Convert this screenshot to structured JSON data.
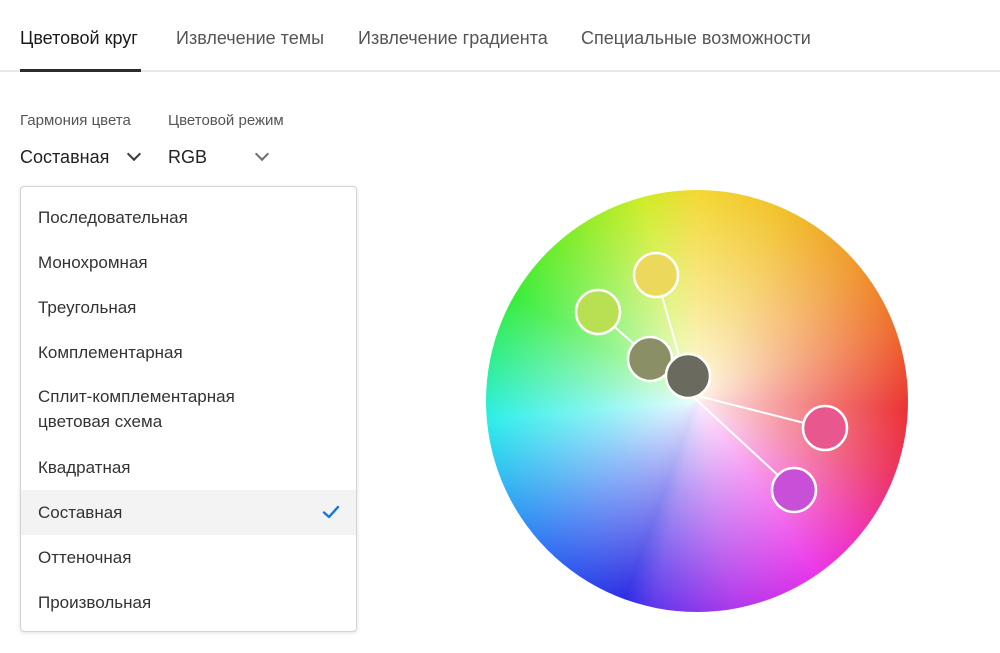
{
  "tabs": [
    {
      "label": "Цветовой круг",
      "active": true
    },
    {
      "label": "Извлечение темы",
      "active": false
    },
    {
      "label": "Извлечение градиента",
      "active": false
    },
    {
      "label": "Специальные возможности",
      "active": false
    }
  ],
  "harmony": {
    "label": "Гармония цвета",
    "value": "Составная"
  },
  "color_mode": {
    "label": "Цветовой режим",
    "value": "RGB"
  },
  "menu": {
    "items": [
      "Последовательная",
      "Монохромная",
      "Треугольная",
      "Комплементарная",
      "Сплит-комплементарная цветовая схема",
      "Квадратная",
      "Составная",
      "Оттеночная",
      "Произвольная"
    ],
    "selected": "Составная"
  },
  "colors": {
    "swatch_1": "#b9e052",
    "swatch_2": "#ecd85a",
    "swatch_3": "#8a8f66",
    "swatch_4": "#6b6a5e",
    "swatch_5": "#e8578e",
    "swatch_6": "#c84fd8",
    "accent_check": "#1473e6"
  }
}
